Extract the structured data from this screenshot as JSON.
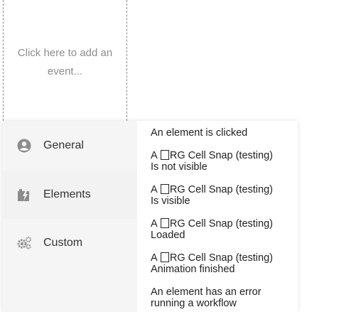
{
  "event_placeholder": "Click here to add an event...",
  "categories": [
    {
      "label": "General",
      "icon": "user-circle-icon"
    },
    {
      "label": "Elements",
      "icon": "element-bolt-icon"
    },
    {
      "label": "Custom",
      "icon": "gears-icon"
    }
  ],
  "events": [
    {
      "line1": "An element is clicked"
    },
    {
      "prefix": "A",
      "name": "RG Cell Snap (testing)",
      "line2": "Is not visible"
    },
    {
      "prefix": "A",
      "name": "RG Cell Snap (testing)",
      "line2": "Is visible"
    },
    {
      "prefix": "A",
      "name": "RG Cell Snap (testing)",
      "line2": "Loaded"
    },
    {
      "prefix": "A",
      "name": "RG Cell Snap (testing)",
      "line2": "Animation finished"
    },
    {
      "line1": "An element has an error running a workflow"
    }
  ]
}
